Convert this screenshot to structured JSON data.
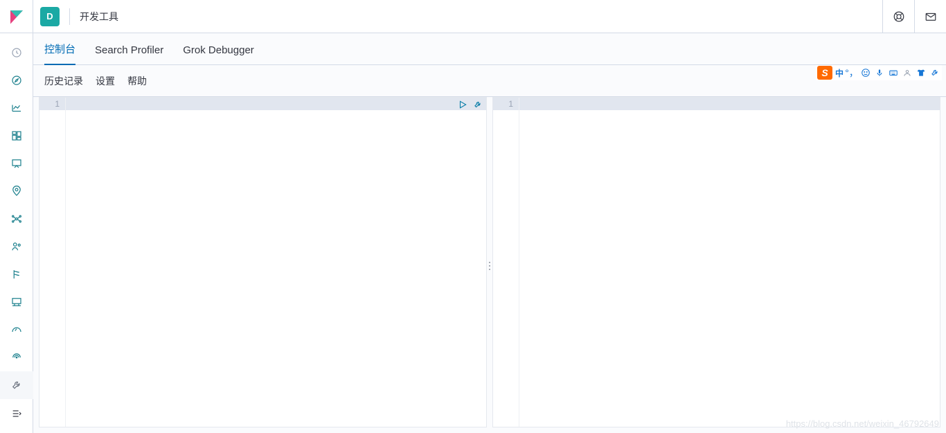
{
  "header": {
    "app_badge_letter": "D",
    "app_title": "开发工具"
  },
  "tabs": [
    {
      "label": "控制台",
      "active": true
    },
    {
      "label": "Search Profiler",
      "active": false
    },
    {
      "label": "Grok Debugger",
      "active": false
    }
  ],
  "subbar": {
    "history": "历史记录",
    "settings": "设置",
    "help": "帮助"
  },
  "editor": {
    "left_line_no": "1",
    "right_line_no": "1"
  },
  "ime": {
    "logo_letter": "S",
    "lang_label": "中"
  },
  "watermark": "https://blog.csdn.net/weixin_46792649",
  "sidebar_icons": [
    "recent",
    "discover",
    "visualize",
    "dashboard",
    "canvas",
    "maps",
    "ml",
    "infra",
    "logs",
    "apm",
    "uptime",
    "siem",
    "dev-tools"
  ]
}
